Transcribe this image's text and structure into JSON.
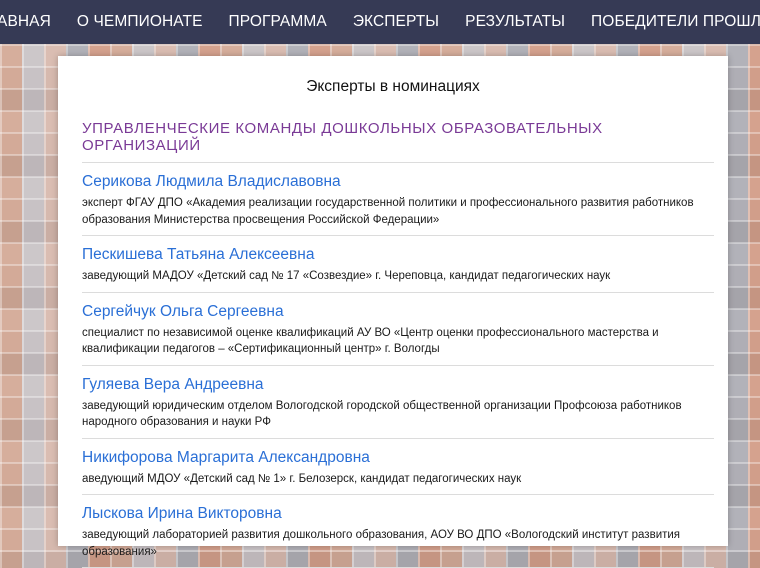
{
  "nav": {
    "items": [
      {
        "label": "АВНАЯ"
      },
      {
        "label": "О ЧЕМПИОНАТЕ"
      },
      {
        "label": "ПРОГРАММА"
      },
      {
        "label": "ЭКСПЕРТЫ"
      },
      {
        "label": "РЕЗУЛЬТАТЫ"
      },
      {
        "label": "ПОБЕДИТЕЛИ ПРОШЛЫХ ЛЕТ"
      }
    ]
  },
  "page": {
    "title": "Эксперты в номинациях",
    "section_heading": "Управленческие команды дошкольных образовательных организаций"
  },
  "experts": [
    {
      "name": "Серикова Людмила Владиславовна",
      "desc": "эксперт ФГАУ ДПО «Академия реализации государственной политики и профессионального развития работников образования Министерства просвещения Российской Федерации»"
    },
    {
      "name": "Пескишева Татьяна Алексеевна",
      "desc": "заведующий МАДОУ «Детский сад № 17 «Созвездие» г. Череповца, кандидат педагогических наук"
    },
    {
      "name": "Сергейчук Ольга Сергеевна",
      "desc": "специалист по независимой оценке квалификаций АУ ВО «Центр оценки профессионального мастерства и квалификации педагогов – «Сертификационный центр» г. Вологды"
    },
    {
      "name": "Гуляева Вера Андреевна",
      "desc": "заведующий юридическим отделом Вологодской городской общественной организации Профсоюза работников народного образования и науки РФ"
    },
    {
      "name": "Никифорова Маргарита Александровна",
      "desc": "аведующий МДОУ «Детский сад № 1» г. Белозерск, кандидат педагогических наук"
    },
    {
      "name": "Лыскова Ирина Викторовна",
      "desc": "заведующий лабораторией развития дошкольного образования, АОУ ВО ДПО «Вологодский институт развития образования»"
    }
  ]
}
